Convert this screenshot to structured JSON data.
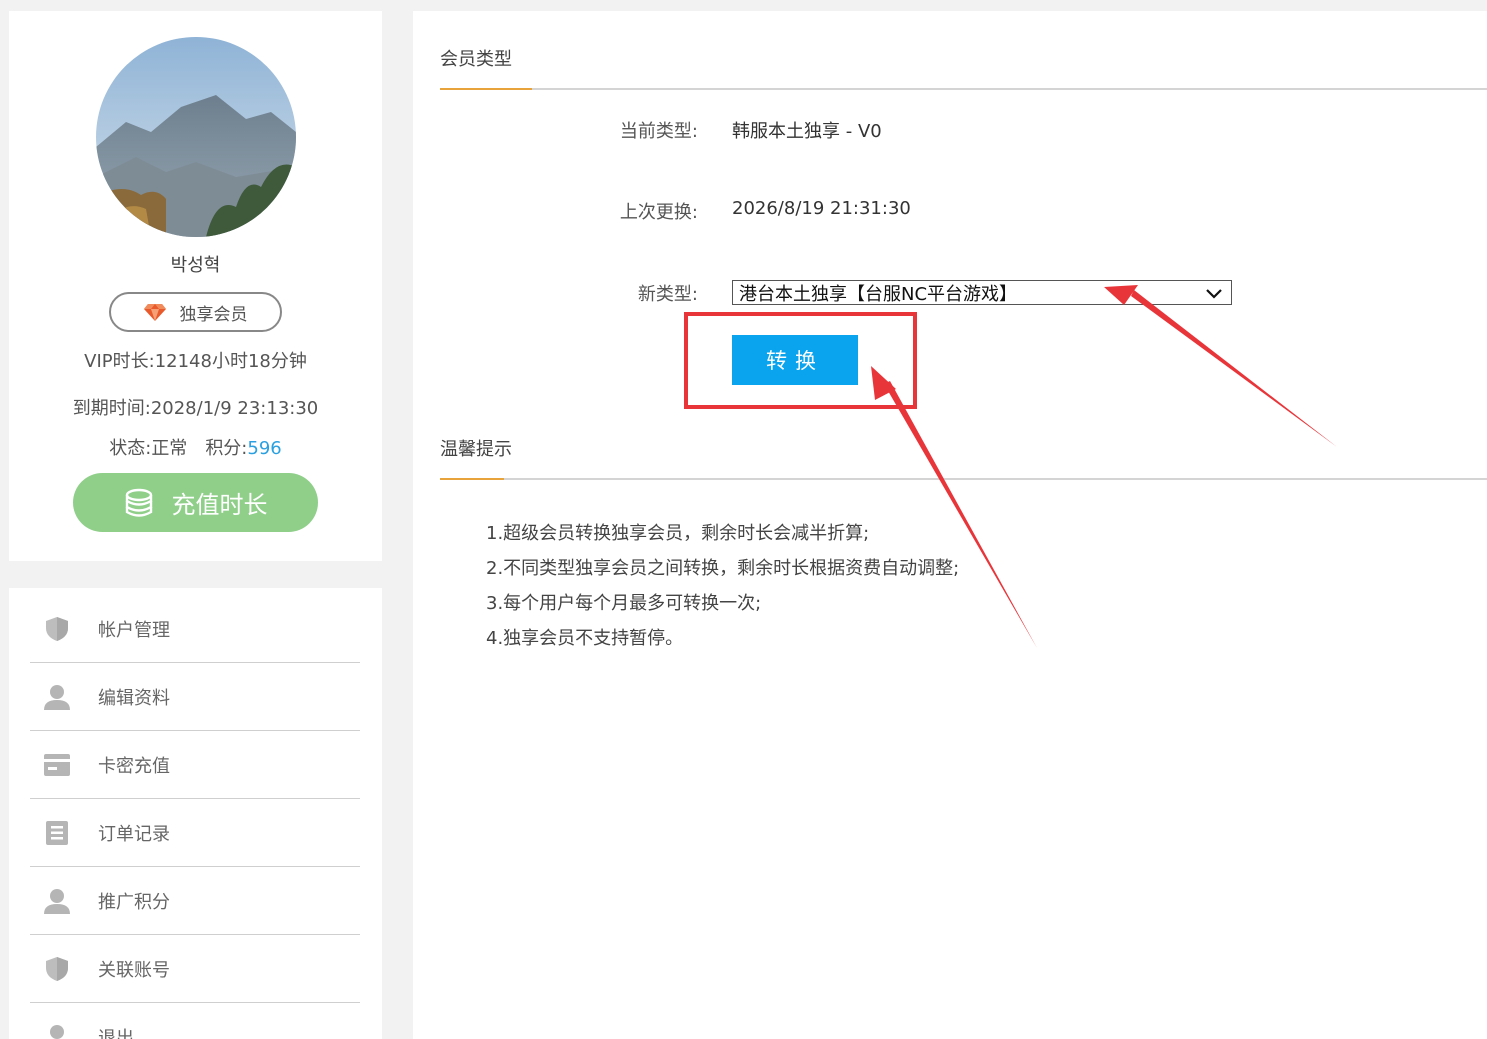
{
  "profile": {
    "username": "박성혁",
    "badge_label": "独享会员",
    "vip_duration_label": "VIP时长:",
    "vip_duration_value": "12148小时18分钟",
    "expire_label": "到期时间:",
    "expire_value": "2028/1/9 23:13:30",
    "status_label": "状态:",
    "status_value": "正常",
    "points_label": "积分:",
    "points_value": "596",
    "recharge_label": "充值时长"
  },
  "menu": {
    "items": [
      {
        "label": "帐户管理",
        "icon": "shield-icon"
      },
      {
        "label": "编辑资料",
        "icon": "user-icon"
      },
      {
        "label": "卡密充值",
        "icon": "card-icon"
      },
      {
        "label": "订单记录",
        "icon": "list-icon"
      },
      {
        "label": "推广积分",
        "icon": "user-icon"
      },
      {
        "label": "关联账号",
        "icon": "shield-icon"
      },
      {
        "label": "退出",
        "icon": "user-icon"
      }
    ]
  },
  "member_type": {
    "title": "会员类型",
    "current_label": "当前类型:",
    "current_value": "韩服本土独享 - V0",
    "last_change_label": "上次更换:",
    "last_change_value": "2026/8/19 21:31:30",
    "new_type_label": "新类型:",
    "new_type_selected": "港台本土独享【台服NC平台游戏】",
    "convert_label": "转换"
  },
  "tips": {
    "title": "温馨提示",
    "items": [
      "1.超级会员转换独享会员，剩余时长会减半折算;",
      "2.不同类型独享会员之间转换，剩余时长根据资费自动调整;",
      "3.每个用户每个月最多可转换一次;",
      "4.独享会员不支持暂停。"
    ]
  },
  "colors": {
    "accent_orange": "#e8a33a",
    "button_blue": "#0aa3ee",
    "recharge_green": "#8fcf8a",
    "annotation_red": "#e8353a",
    "points_blue": "#2aa0e0"
  }
}
